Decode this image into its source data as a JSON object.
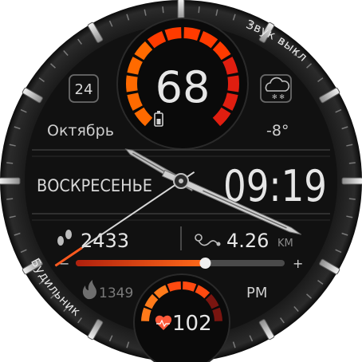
{
  "bezel": {
    "top_right_label": "Звук выкл",
    "bottom_left_label": "Будильник"
  },
  "battery": {
    "value": "68",
    "level_fraction": 0.68,
    "arc_colors": [
      "#ff6a00",
      "#ff3b00",
      "#e01e10",
      "#6a1410"
    ]
  },
  "date": {
    "day_number": "24",
    "month": "Октябрь",
    "weekday": "ВОСКРЕСЕНЬЕ"
  },
  "weather": {
    "icon": "cloud-snow-icon",
    "temperature": "-8°"
  },
  "time": {
    "digital": "09:19",
    "ampm": "PM",
    "hour_hand_angle_deg": 300,
    "minute_hand_angle_deg": 114
  },
  "activity": {
    "steps": "2433",
    "steps_icon": "footprints-icon",
    "distance": "4.26",
    "distance_unit": "KM",
    "distance_icon": "route-icon",
    "calories": "1349",
    "calories_icon": "flame-icon",
    "progress_fraction": 0.62,
    "minus_label": "−",
    "plus_label": "+"
  },
  "heart": {
    "value": "102",
    "icon": "heart-pulse-icon"
  },
  "colors": {
    "accent": "#ff5a1f",
    "accent_dark": "#b0200d",
    "text": "#e6e6e6",
    "muted": "#8a8a8a"
  }
}
